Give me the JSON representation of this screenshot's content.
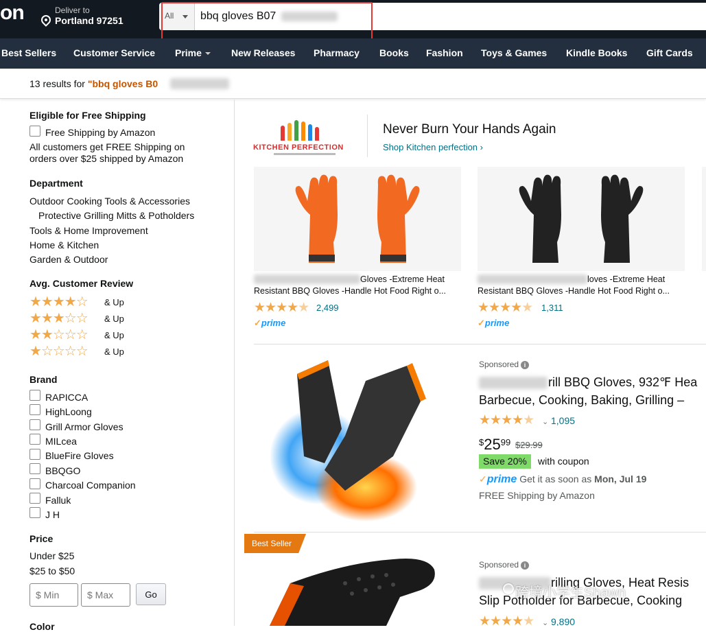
{
  "header": {
    "logo": "on",
    "deliver_to_label": "Deliver to",
    "deliver_to_location": "Portland 97251",
    "search_category": "All",
    "search_value": "bbq gloves B07"
  },
  "nav": {
    "items": [
      "Best Sellers",
      "Customer Service",
      "Prime",
      "New Releases",
      "Pharmacy",
      "Books",
      "Fashion",
      "Toys & Games",
      "Kindle Books",
      "Gift Cards"
    ]
  },
  "results": {
    "prefix": "13 results for",
    "query": "\"bbq gloves B0"
  },
  "sidebar": {
    "free_shipping_heading": "Eligible for Free Shipping",
    "free_shipping_option": "Free Shipping by Amazon",
    "free_shipping_note_1": "All customers get FREE Shipping on",
    "free_shipping_note_2": "orders over $25 shipped by Amazon",
    "department_heading": "Department",
    "departments": [
      "Outdoor Cooking Tools & Accessories",
      "Protective Grilling Mitts & Potholders",
      "Tools & Home Improvement",
      "Home & Kitchen",
      "Garden & Outdoor"
    ],
    "review_heading": "Avg. Customer Review",
    "review_and_up": "& Up",
    "review_levels": [
      4,
      3,
      2,
      1
    ],
    "brand_heading": "Brand",
    "brands": [
      "RAPICCA",
      "HighLoong",
      "Grill Armor Gloves",
      "MILcea",
      "BlueFire Gloves",
      "BBQGO",
      "Charcoal Companion",
      "Falluk",
      "J H"
    ],
    "price_heading": "Price",
    "price_ranges": [
      "Under $25",
      "$25 to $50"
    ],
    "price_min_placeholder": "$ Min",
    "price_max_placeholder": "$ Max",
    "go_label": "Go",
    "color_heading": "Color"
  },
  "banner": {
    "brand_logo_text": "KITCHEN PERFECTION",
    "title": "Never Burn Your Hands Again",
    "link": "Shop Kitchen perfection ›",
    "cards": [
      {
        "title_line1": "Gloves -Extreme Heat",
        "title_line2": "Resistant BBQ Gloves -Handle Hot Food Right o...",
        "rating": 4.5,
        "reviews": "2,499",
        "prime": "prime",
        "glove_color": "#f26a21"
      },
      {
        "title_line1": "loves -Extreme Heat",
        "title_line2": "Resistant BBQ Gloves -Handle Hot Food Right o...",
        "rating": 4.5,
        "reviews": "1,311",
        "prime": "prime",
        "glove_color": "#222222"
      }
    ]
  },
  "products": [
    {
      "sponsored": "Sponsored",
      "title_line1": "rill BBQ Gloves, 932℉ Hea",
      "title_line2": "Barbecue, Cooking, Baking, Grilling –",
      "rating": 4.5,
      "reviews": "1,095",
      "price_currency": "$",
      "price_whole": "25",
      "price_fraction": "99",
      "list_price": "$29.99",
      "coupon": "Save 20%",
      "coupon_suffix": "with coupon",
      "prime": "prime",
      "delivery_prefix": "Get it as soon as",
      "delivery_date": "Mon, Jul 19",
      "shipping": "FREE Shipping by Amazon"
    },
    {
      "badge": "Best Seller",
      "sponsored": "Sponsored",
      "title_line1": "rilling Gloves, Heat Resis",
      "title_line2": "Slip Potholder for Barbecue, Cooking",
      "rating": 4.5,
      "reviews": "9,890"
    }
  ],
  "watermark": "跨境小学生Shawn",
  "colors": {
    "topbar": "#131921",
    "navbar": "#232f3e",
    "link": "#007185",
    "star": "#f3a847",
    "prime": "#1399ff",
    "coupon": "#7fda69",
    "best_seller": "#e47911",
    "highlight_box": "#e53935"
  }
}
